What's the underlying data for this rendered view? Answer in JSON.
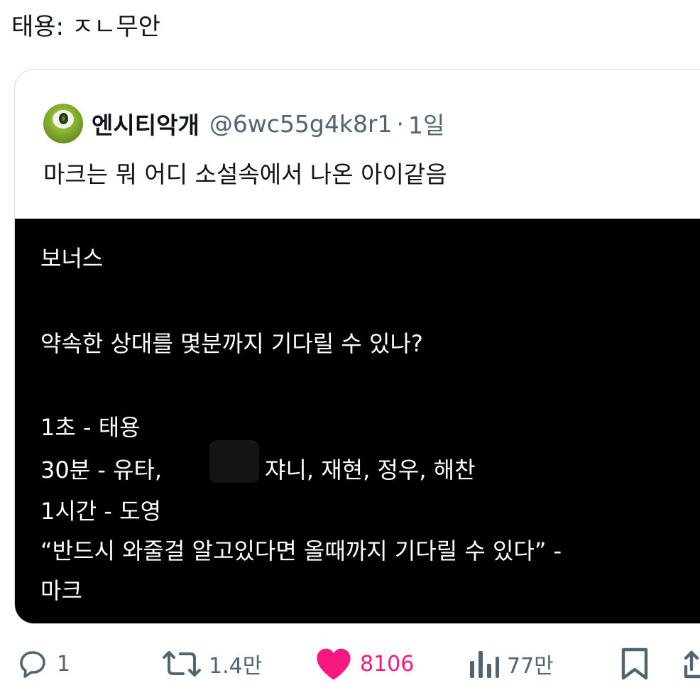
{
  "reply": {
    "text": "태용: ㅈㄴ무안"
  },
  "quoted_tweet": {
    "display_name": "엔시티악개",
    "handle": "@6wc55g4k8r1",
    "separator": "·",
    "time": "1일",
    "text": "마크는 뭐 어디 소설속에서 나온 아이같음",
    "media_lines": [
      "보너스",
      "약속한 상대를 몇분까지 기다릴 수 있나?",
      "1초 - 태용",
      "30분 - 유타,",
      "쟈니, 재현, 정우, 해찬",
      "1시간 - 도영",
      "“반드시 와줄걸 알고있다면 올때까지 기다릴 수 있다” -",
      "마크"
    ]
  },
  "actions": {
    "replies": "1",
    "retweets": "1.4만",
    "likes": "8106",
    "views": "77만"
  },
  "colors": {
    "text": "#0f1419",
    "secondary": "#536471",
    "like": "#f91880",
    "border": "#d6dbdf",
    "media_bg": "#000000"
  },
  "icons": [
    "avatar",
    "reply-icon",
    "retweet-icon",
    "heart-icon",
    "views-icon",
    "bookmark-icon",
    "share-icon"
  ]
}
